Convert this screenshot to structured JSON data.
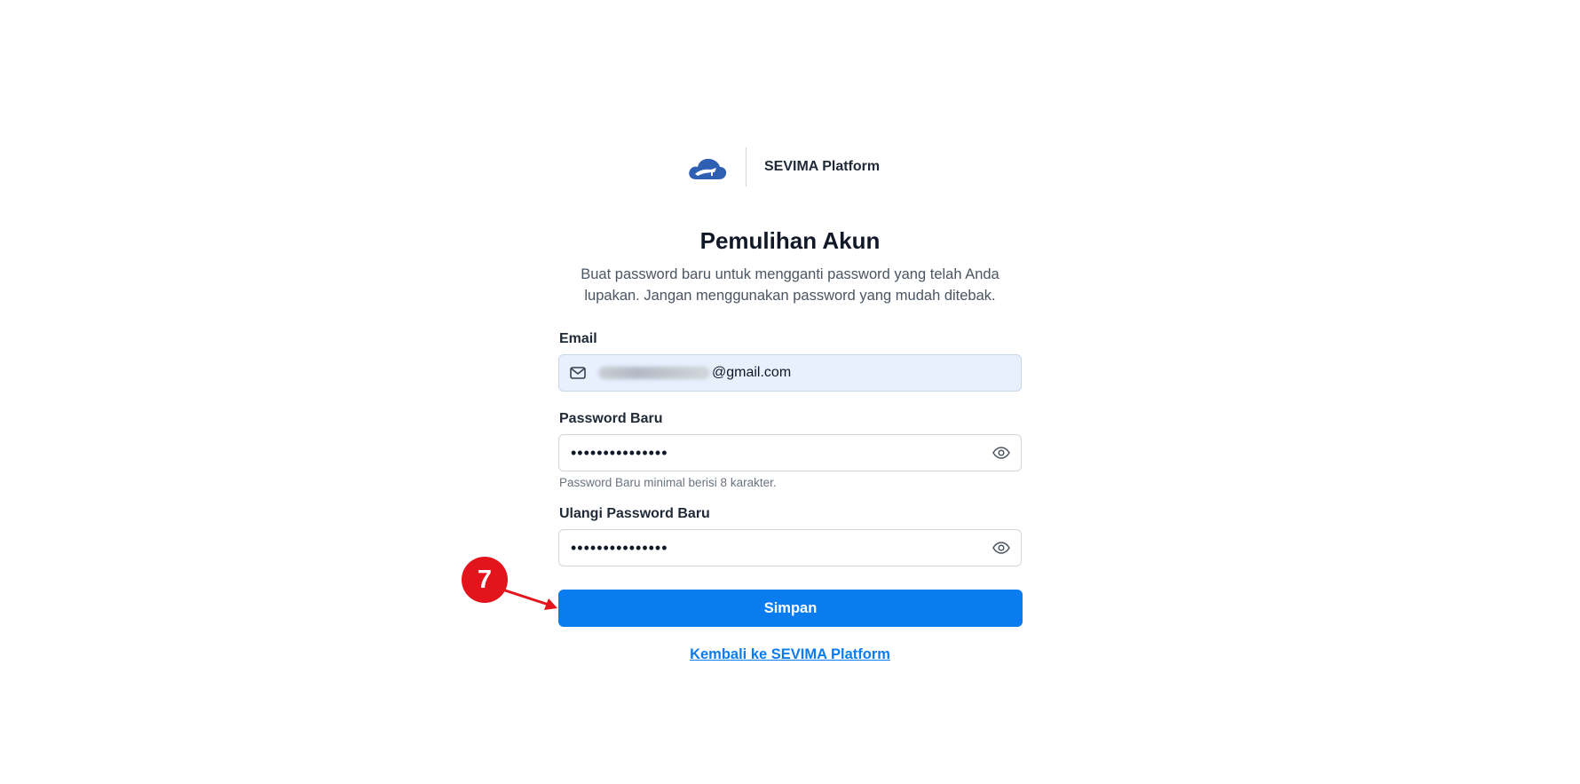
{
  "brand": {
    "logo_icon": "cloud-logo-icon",
    "name": "SEVIMA Platform"
  },
  "page": {
    "title": "Pemulihan Akun",
    "subtitle": "Buat password baru untuk mengganti password yang telah Anda lupakan. Jangan menggunakan password yang mudah ditebak."
  },
  "form": {
    "email": {
      "label": "Email",
      "icon": "mail-icon",
      "value_domain": "@gmail.com"
    },
    "new_password": {
      "label": "Password Baru",
      "value": "•••••••••••••••",
      "helper": "Password Baru minimal berisi 8 karakter.",
      "toggle_icon": "eye-icon"
    },
    "confirm_password": {
      "label": "Ulangi Password Baru",
      "value": "•••••••••••••••",
      "toggle_icon": "eye-icon"
    },
    "submit_label": "Simpan"
  },
  "back_link": "Kembali ke SEVIMA Platform",
  "annotation": {
    "step_number": "7",
    "color": "#e3141b"
  },
  "colors": {
    "primary": "#0b7cef",
    "email_field_bg": "#e8f0fe",
    "logo": "#2f5fb3"
  }
}
